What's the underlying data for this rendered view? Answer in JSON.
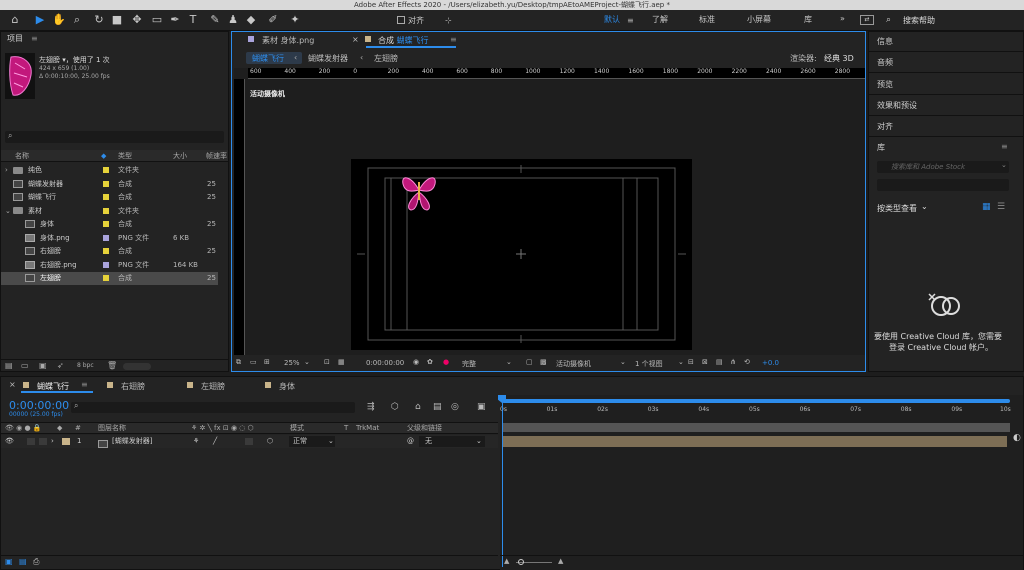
{
  "window": {
    "title": "Adobe After Effects 2020 - /Users/elizabeth.yu/Desktop/tmpAEtoAMEProject-蝴蝶飞行.aep *"
  },
  "toolbar": {
    "align_label": "对齐",
    "workspaces": [
      "默认",
      "了解",
      "标准",
      "小屏幕",
      "库"
    ],
    "more": "»",
    "search_placeholder": "搜索帮助"
  },
  "project": {
    "title": "项目",
    "selected_name": "左翅膀 ▾",
    "used": "，使用了 1 次",
    "dims": "424 x 659 (1.00)",
    "duration": "Δ 0:00:10:00, 25.00 fps",
    "search_placeholder": "",
    "columns": {
      "name": "名称",
      "type": "类型",
      "size": "大小",
      "fps": "帧速率"
    },
    "rows": [
      {
        "name": "纯色",
        "type": "文件夹",
        "size": "",
        "fps": "",
        "color": "#e6d23a",
        "kind": "folder",
        "indent": 0,
        "selected": false
      },
      {
        "name": "蝴蝶发射器",
        "type": "合成",
        "size": "",
        "fps": "25",
        "color": "#e6d23a",
        "kind": "comp",
        "indent": 0,
        "selected": false
      },
      {
        "name": "蝴蝶飞行",
        "type": "合成",
        "size": "",
        "fps": "25",
        "color": "#e6d23a",
        "kind": "comp",
        "indent": 0,
        "selected": false
      },
      {
        "name": "素材",
        "type": "文件夹",
        "size": "",
        "fps": "",
        "color": "#e6d23a",
        "kind": "folder",
        "indent": 0,
        "selected": false
      },
      {
        "name": "身体",
        "type": "合成",
        "size": "",
        "fps": "25",
        "color": "#e6d23a",
        "kind": "comp",
        "indent": 1,
        "selected": false
      },
      {
        "name": "身体.png",
        "type": "PNG 文件",
        "size": "6 KB",
        "fps": "",
        "color": "#a9a3dc",
        "kind": "png",
        "indent": 1,
        "selected": false
      },
      {
        "name": "右翅膀",
        "type": "合成",
        "size": "",
        "fps": "25",
        "color": "#e6d23a",
        "kind": "comp",
        "indent": 1,
        "selected": false
      },
      {
        "name": "右翅膀.png",
        "type": "PNG 文件",
        "size": "164 KB",
        "fps": "",
        "color": "#a9a3dc",
        "kind": "png",
        "indent": 1,
        "selected": false
      },
      {
        "name": "左翅膀",
        "type": "合成",
        "size": "",
        "fps": "25",
        "color": "#e6d23a",
        "kind": "comp",
        "indent": 1,
        "selected": true
      }
    ],
    "bpc": "8 bpc"
  },
  "composition": {
    "tab_footage": "素材 身体.png",
    "tab_comp_prefix": "合成",
    "tab_comp_name": "蝴蝶飞行",
    "breadcrumbs": [
      "蝴蝶飞行",
      "蝴蝶发射器",
      "左翅膀"
    ],
    "renderer_label": "渲染器:",
    "renderer_value": "经典 3D",
    "camera_label": "活动摄像机",
    "ruler_ticks": [
      "600",
      "400",
      "200",
      "0",
      "200",
      "400",
      "600",
      "800",
      "1000",
      "1200",
      "1400",
      "1600",
      "1800",
      "2000",
      "2200",
      "2400",
      "2600",
      "2800"
    ],
    "zoom": "25%",
    "timecode": "0:00:00:00",
    "resolution": "完整",
    "view_camera": "活动摄像机",
    "views": "1 个视图",
    "exposure": "+0.0"
  },
  "right_panel": {
    "items": [
      "信息",
      "音频",
      "预览",
      "效果和预设",
      "对齐"
    ],
    "library": {
      "title": "库",
      "search_placeholder": "搜索库和 Adobe Stock",
      "view_by": "按类型查看",
      "message_line1": "要使用 Creative Cloud 库，您需要",
      "message_line2": "登录 Creative Cloud 帐户。"
    }
  },
  "timeline": {
    "tabs": [
      "蝴蝶飞行",
      "右翅膀",
      "左翅膀",
      "身体"
    ],
    "tab_colors": [
      "#c9b48a",
      "#c9b48a",
      "#c9b48a",
      "#c9b48a"
    ],
    "timecode": "0:00:00:00",
    "timecode_sub": "00000 (25.00 fps)",
    "columns": {
      "layer_name": "图层名称",
      "mode": "模式",
      "t": "T",
      "trkmat": "TrkMat",
      "parent": "父级和链接"
    },
    "ruler": [
      "0s",
      "01s",
      "02s",
      "03s",
      "04s",
      "05s",
      "06s",
      "07s",
      "08s",
      "09s",
      "10s"
    ],
    "layers": [
      {
        "index": "1",
        "name": "[蝴蝶发射器]",
        "mode": "正常",
        "parent": "无"
      }
    ]
  }
}
